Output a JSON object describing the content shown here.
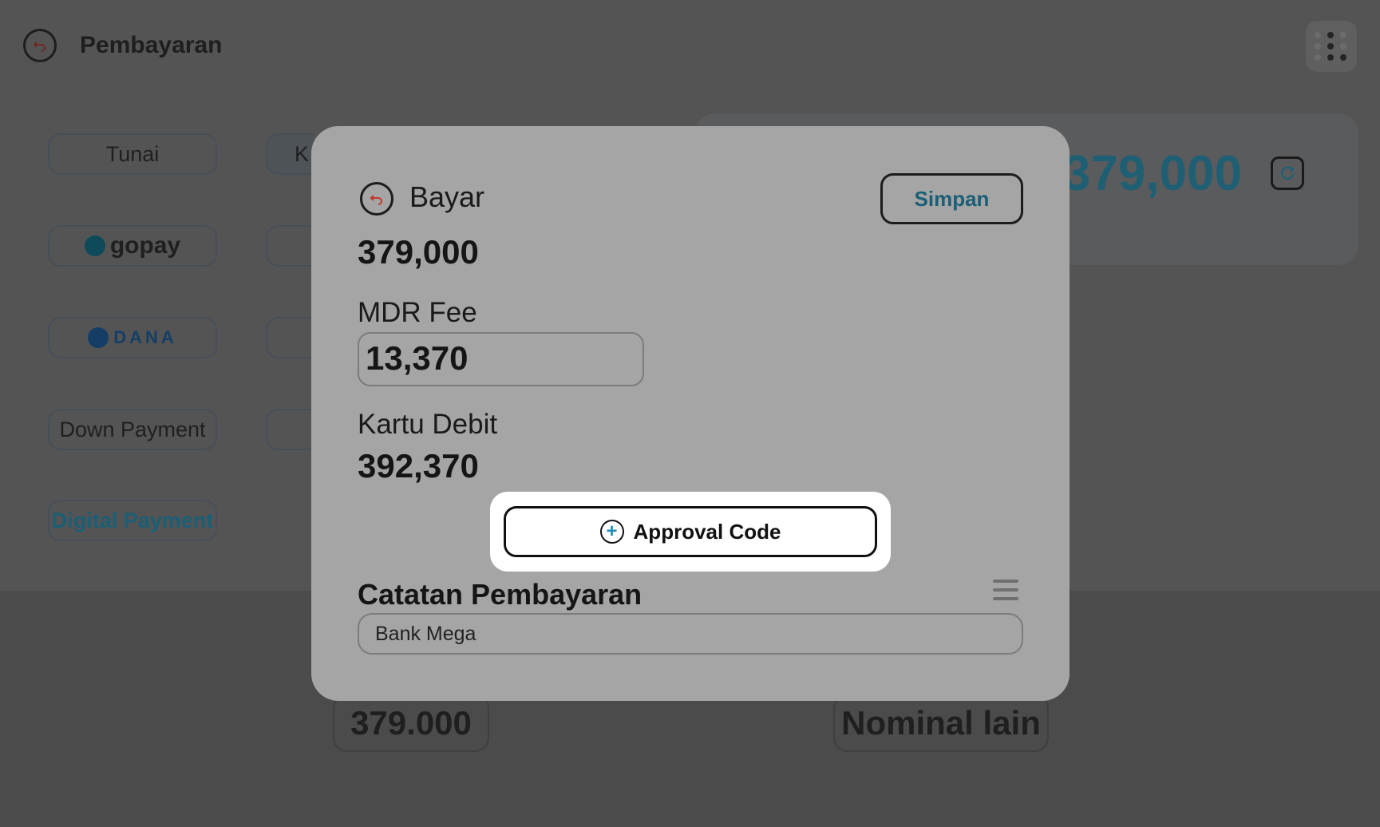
{
  "header": {
    "title": "Pembayaran"
  },
  "payment_methods": [
    {
      "label": "Tunai"
    },
    {
      "label": "gopay"
    },
    {
      "label": "DANA"
    },
    {
      "label": "Down Payment"
    },
    {
      "label": "Digital Payment"
    }
  ],
  "partial_tab": {
    "label": "K"
  },
  "summary": {
    "amount": "379,000"
  },
  "bottom": {
    "quick_amount": "379.000",
    "other_amount": "Nominal lain"
  },
  "modal": {
    "title": "Bayar",
    "save_label": "Simpan",
    "pay_amount": "379,000",
    "mdr_label": "MDR Fee",
    "mdr_value": "13,370",
    "card_label": "Kartu Debit",
    "card_amount": "392,370",
    "approval_label": "Approval Code",
    "notes_label": "Catatan Pembayaran",
    "notes_value": "Bank Mega"
  },
  "colors": {
    "accent": "#1a5f76",
    "overlay": "#545454",
    "modal": "#a5a5a5",
    "back_icon": "#c0392b"
  }
}
